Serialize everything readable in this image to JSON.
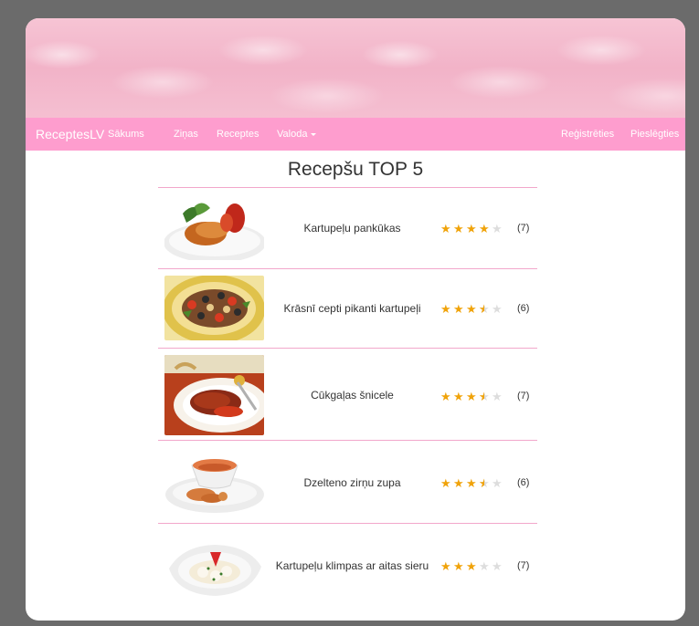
{
  "nav": {
    "brand": "ReceptesLV",
    "items": [
      "Sākums",
      "Ziņas",
      "Receptes",
      "Valoda"
    ],
    "right_items": [
      "Reģistrēties",
      "Pieslēgties"
    ]
  },
  "page_title": "Recepšu TOP 5",
  "recipes": [
    {
      "name": "Kartupeļu pankūkas",
      "rating": 4,
      "count": "(7)"
    },
    {
      "name": "Krāsnī cepti pikanti kartupeļi",
      "rating": 3.5,
      "count": "(6)"
    },
    {
      "name": "Cūkgaļas šnicele",
      "rating": 3.5,
      "count": "(7)"
    },
    {
      "name": "Dzelteno zirņu zupa",
      "rating": 3.5,
      "count": "(6)"
    },
    {
      "name": "Kartupeļu klimpas ar aitas sieru",
      "rating": 3,
      "count": "(7)"
    }
  ],
  "colors": {
    "navbar": "#fe9dce",
    "star": "#f0a30a",
    "star_empty": "#dddddd",
    "divider": "#f2a7cb"
  }
}
